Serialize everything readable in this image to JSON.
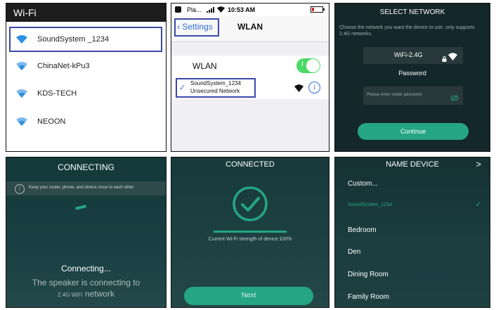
{
  "android_wifi": {
    "title": "Wi-Fi",
    "networks": [
      "SoundSystem _1234",
      "ChinaNet-kPu3",
      "KDS-TECH",
      "NEOON"
    ]
  },
  "ios_wlan": {
    "status_carrier": "Pla...",
    "status_time": "10:53 AM",
    "back_label": "Settings",
    "nav_title": "WLAN",
    "wlan_label": "WLAN",
    "toggle_glyph": "I",
    "network_name": "SoundSystem_1234",
    "network_subtitle": "Unsecured Network",
    "check_glyph": "✓",
    "info_glyph": "i",
    "accent_color": "#2f6fd9",
    "toggle_color": "#4cd964"
  },
  "select_network": {
    "title": "SELECT NETWORK",
    "description": "Choose the network you want the device to use. only supports 2.4G networks.",
    "wifi_name": "WiFi-2.4G",
    "password_label": "Password",
    "password_placeholder": "Please enter router password",
    "continue_label": "Continue"
  },
  "connecting": {
    "title": "CONNECTING",
    "tip_icon_glyph": "!",
    "tip": "Keep your router, phone, and device close to each other.",
    "status": "Connecting...",
    "line2": "The speaker is connecting to",
    "line3_small": "2.4G WiFi",
    "line3_rest": " network"
  },
  "connected": {
    "title": "CONNECTED",
    "strength_text": "Current Wi-Fi strength of device:100%",
    "next_label": "Next"
  },
  "name_device": {
    "title": "NAME DEVICE",
    "next_arrow": ">",
    "items": [
      "Custom...",
      "SoundSystem_1234",
      "Bedroom",
      "Den",
      "Dining Room",
      "Family Room"
    ],
    "selected_tick": "✓",
    "accent_color": "#25a583"
  }
}
